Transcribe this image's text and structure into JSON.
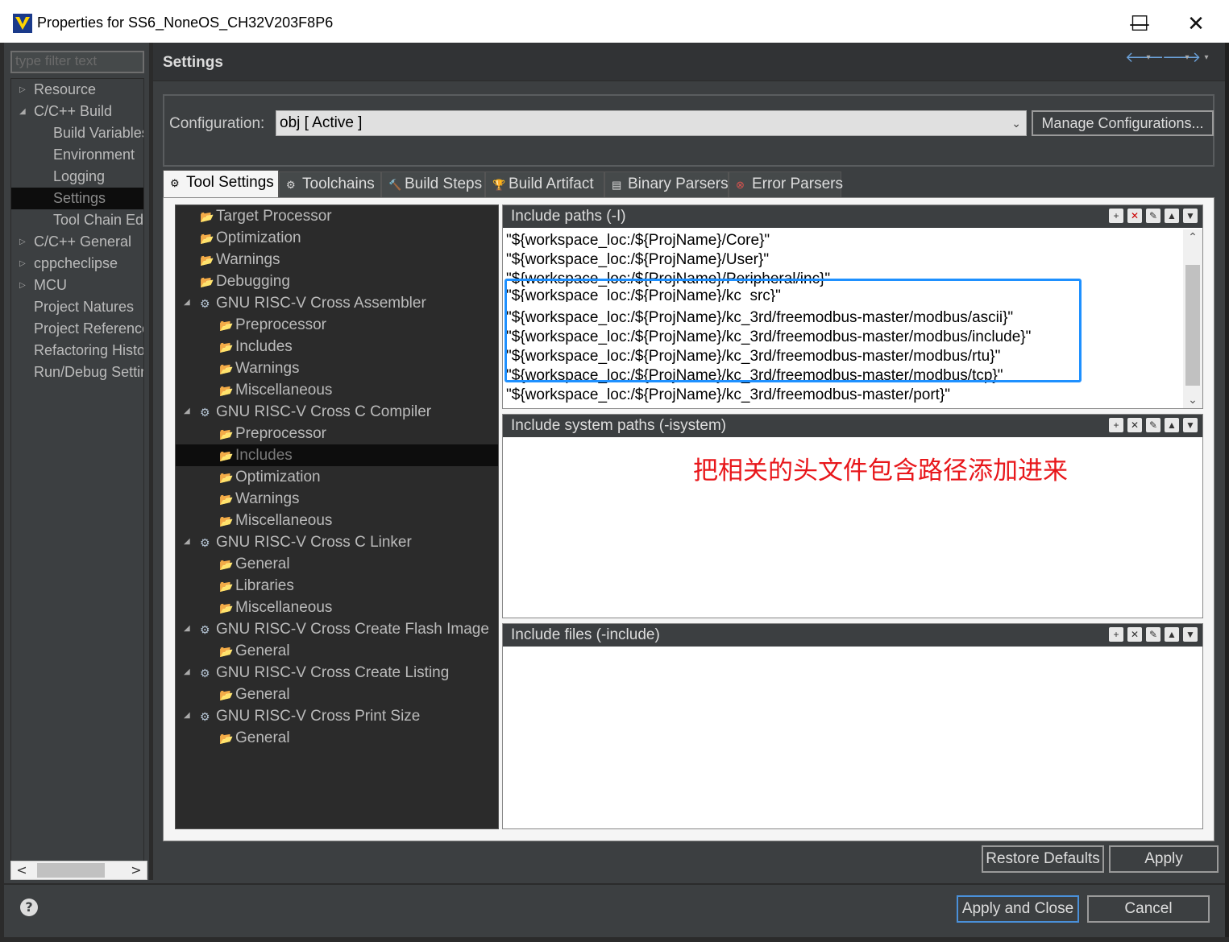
{
  "window": {
    "title": "Properties for SS6_NoneOS_CH32V203F8P6",
    "minimize": "—",
    "maximize": "☐",
    "close": "✕"
  },
  "filter": {
    "placeholder": "type filter text"
  },
  "nav": {
    "items": [
      {
        "label": "Resource",
        "twisty": "▷"
      },
      {
        "label": "C/C++ Build",
        "twisty": "◢"
      },
      {
        "label": "Build Variables"
      },
      {
        "label": "Environment"
      },
      {
        "label": "Logging"
      },
      {
        "label": "Settings"
      },
      {
        "label": "Tool Chain Editor"
      },
      {
        "label": "C/C++ General",
        "twisty": "▷"
      },
      {
        "label": "cppcheclipse",
        "twisty": "▷"
      },
      {
        "label": "MCU",
        "twisty": "▷"
      },
      {
        "label": "Project Natures"
      },
      {
        "label": "Project References"
      },
      {
        "label": "Refactoring History"
      },
      {
        "label": "Run/Debug Settings"
      }
    ],
    "scroll_left": "<",
    "scroll_right": ">"
  },
  "header": {
    "title": "Settings",
    "back": "🡐",
    "forward": "🡒",
    "drop": "▾"
  },
  "config": {
    "label": "Configuration:",
    "value": "obj  [ Active ]",
    "manage": "Manage Configurations..."
  },
  "tabs": [
    {
      "label": "Tool Settings",
      "icon": "⚙"
    },
    {
      "label": "Toolchains",
      "icon": "⚙"
    },
    {
      "label": "Build Steps",
      "icon": "🔨"
    },
    {
      "label": "Build Artifact",
      "icon": "🏆"
    },
    {
      "label": "Binary Parsers",
      "icon": "▤"
    },
    {
      "label": "Error Parsers",
      "icon": "⊗"
    }
  ],
  "tool_tree": [
    {
      "label": "Target Processor"
    },
    {
      "label": "Optimization"
    },
    {
      "label": "Warnings"
    },
    {
      "label": "Debugging"
    },
    {
      "label": "GNU RISC-V Cross Assembler"
    },
    {
      "label": "Preprocessor"
    },
    {
      "label": "Includes"
    },
    {
      "label": "Warnings"
    },
    {
      "label": "Miscellaneous"
    },
    {
      "label": "GNU RISC-V Cross C Compiler"
    },
    {
      "label": "Preprocessor"
    },
    {
      "label": "Includes"
    },
    {
      "label": "Optimization"
    },
    {
      "label": "Warnings"
    },
    {
      "label": "Miscellaneous"
    },
    {
      "label": "GNU RISC-V Cross C Linker"
    },
    {
      "label": "General"
    },
    {
      "label": "Libraries"
    },
    {
      "label": "Miscellaneous"
    },
    {
      "label": "GNU RISC-V Cross Create Flash Image"
    },
    {
      "label": "General"
    },
    {
      "label": "GNU RISC-V Cross Create Listing"
    },
    {
      "label": "General"
    },
    {
      "label": "GNU RISC-V Cross Print Size"
    },
    {
      "label": "General"
    }
  ],
  "include_paths": {
    "title": "Include paths (-I)",
    "items": [
      "\"${workspace_loc:/${ProjName}/Core}\"",
      "\"${workspace_loc:/${ProjName}/User}\"",
      "\"${workspace_loc:/${ProjName}/Peripheral/inc}\"",
      "\"${workspace_loc:/${ProjName}/kc_src}\"",
      "\"${workspace_loc:/${ProjName}/kc_3rd/freemodbus-master/modbus/ascii}\"",
      "\"${workspace_loc:/${ProjName}/kc_3rd/freemodbus-master/modbus/include}\"",
      "\"${workspace_loc:/${ProjName}/kc_3rd/freemodbus-master/modbus/rtu}\"",
      "\"${workspace_loc:/${ProjName}/kc_3rd/freemodbus-master/modbus/tcp}\"",
      "\"${workspace_loc:/${ProjName}/kc_3rd/freemodbus-master/port}\""
    ]
  },
  "include_system_paths": {
    "title": "Include system paths (-isystem)"
  },
  "include_files": {
    "title": "Include files (-include)"
  },
  "annotation": "把相关的头文件包含路径添加进来",
  "buttons": {
    "restore": "Restore Defaults",
    "apply": "Apply",
    "apply_close": "Apply and Close",
    "cancel": "Cancel",
    "help": "?"
  },
  "colors": {
    "highlight": "#1e90ff",
    "annotation": "#e8171b",
    "background": "#3c3f41"
  }
}
